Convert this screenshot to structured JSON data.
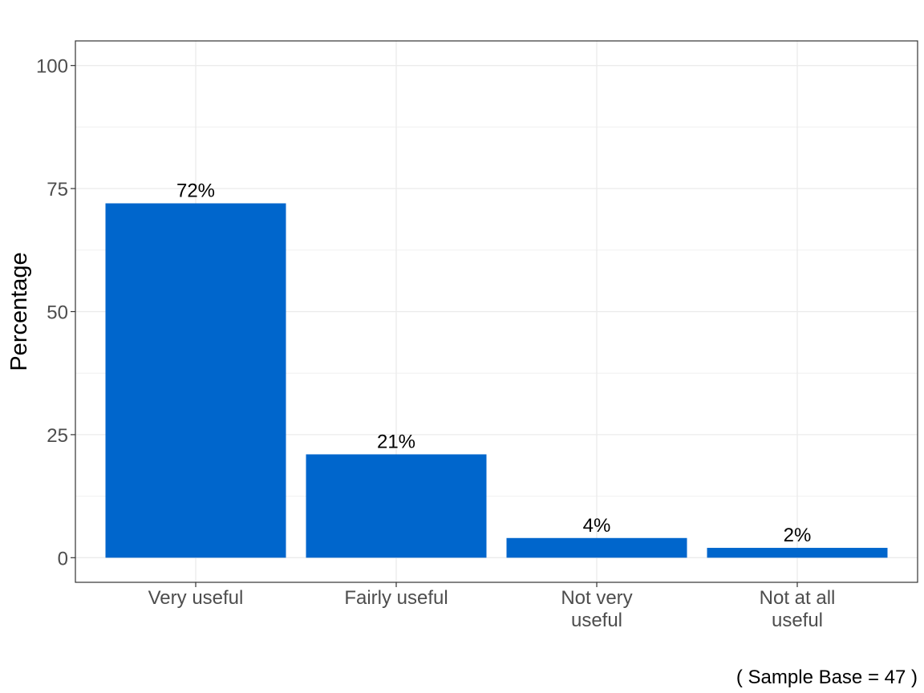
{
  "chart_data": {
    "type": "bar",
    "title": "",
    "xlabel": "",
    "ylabel": "Percentage",
    "categories": [
      [
        "Very useful"
      ],
      [
        "Fairly useful"
      ],
      [
        "Not very",
        "useful"
      ],
      [
        "Not at all",
        "useful"
      ]
    ],
    "values": [
      72,
      21,
      4,
      2
    ],
    "data_labels": [
      "72%",
      "21%",
      "4%",
      "2%"
    ],
    "ylim": [
      -5,
      105
    ],
    "yticks": [
      0,
      25,
      50,
      75,
      100
    ],
    "yminor": [
      12.5,
      37.5,
      62.5,
      87.5
    ],
    "grid": true,
    "bar_color": "#0066cc",
    "caption": "( Sample Base =  47 )"
  }
}
